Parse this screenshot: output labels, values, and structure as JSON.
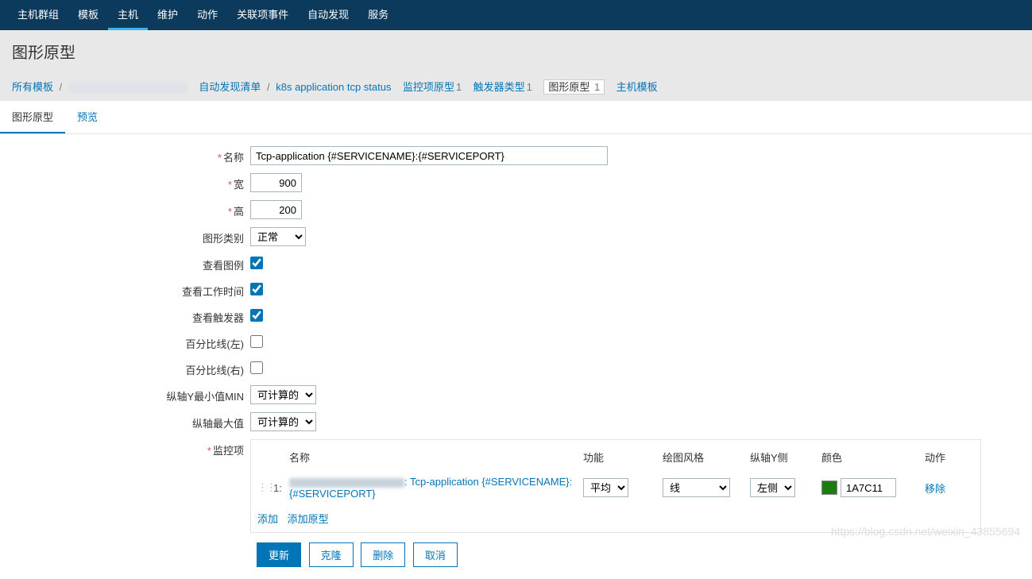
{
  "topnav": {
    "items": [
      "主机群组",
      "模板",
      "主机",
      "维护",
      "动作",
      "关联项事件",
      "自动发现",
      "服务"
    ],
    "active_index": 2
  },
  "page_title": "图形原型",
  "breadcrumb": {
    "all_templates": "所有模板",
    "disc_list": "自动发现清单",
    "app": "k8s application tcp status",
    "item_proto": "监控项原型",
    "item_proto_count": "1",
    "trig_proto": "触发器类型",
    "trig_proto_count": "1",
    "graph_proto": "图形原型",
    "graph_proto_count": "1",
    "host_tpl": "主机模板"
  },
  "tabs": {
    "graph_proto": "图形原型",
    "preview": "预览"
  },
  "form": {
    "name_label": "名称",
    "name_value": "Tcp-application {#SERVICENAME}:{#SERVICEPORT}",
    "width_label": "宽",
    "width_value": "900",
    "height_label": "高",
    "height_value": "200",
    "type_label": "图形类别",
    "type_value": "正常",
    "legend_label": "查看图例",
    "legend_checked": true,
    "worktime_label": "查看工作时间",
    "worktime_checked": true,
    "triggers_label": "查看触发器",
    "triggers_checked": true,
    "pct_left_label": "百分比线(左)",
    "pct_left_checked": false,
    "pct_right_label": "百分比线(右)",
    "pct_right_checked": false,
    "ymin_label": "纵轴Y最小值MIN",
    "ymin_value": "可计算的",
    "ymax_label": "纵轴最大值",
    "ymax_value": "可计算的",
    "items_label": "监控项"
  },
  "items_table": {
    "headers": {
      "name": "名称",
      "func": "功能",
      "style": "绘图风格",
      "yaxis": "纵轴Y侧",
      "color": "颜色",
      "action": "动作"
    },
    "rows": [
      {
        "num": "1:",
        "name_suffix": ": Tcp-application {#SERVICENAME}:{#SERVICEPORT}",
        "func": "平均",
        "style": "线",
        "yaxis": "左侧",
        "color": "1A7C11",
        "remove": "移除"
      }
    ],
    "add": "添加",
    "add_proto": "添加原型"
  },
  "buttons": {
    "update": "更新",
    "clone": "克隆",
    "delete": "删除",
    "cancel": "取消"
  },
  "watermark": "https://blog.csdn.net/weixin_43855694"
}
